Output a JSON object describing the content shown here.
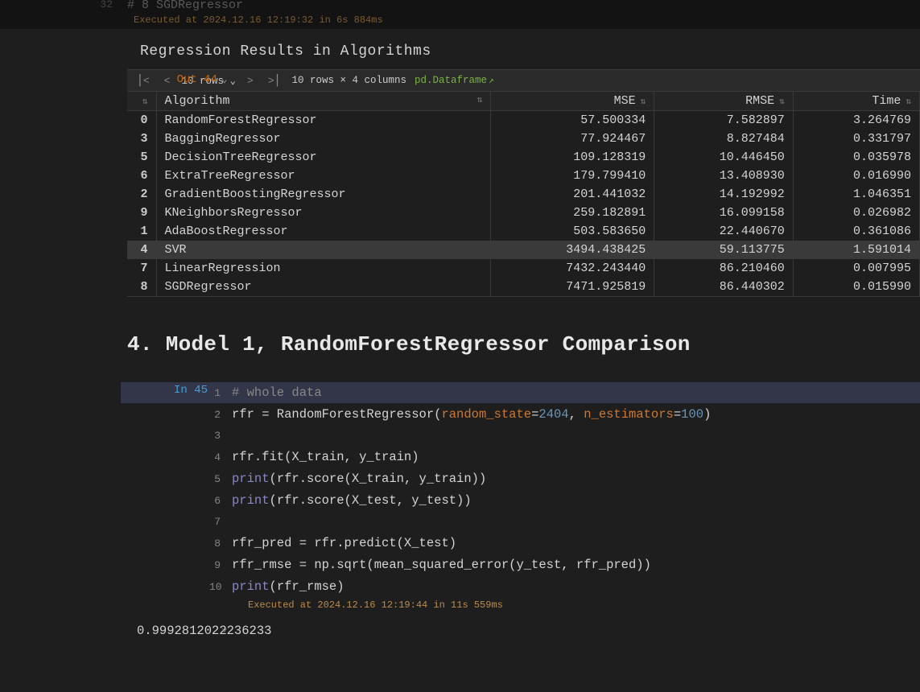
{
  "prev_cell": {
    "gutter": "32",
    "code_frag": "# 8 SGDRegressor",
    "exec": "Executed at 2024.12.16 12:19:32 in 6s 884ms"
  },
  "output_heading": "Regression Results in Algorithms",
  "out_label": "Out 44",
  "df_toolbar": {
    "rows_tag": "10 rows",
    "shape": "10 rows × 4 columns",
    "df_link": "pd.Dataframe"
  },
  "table": {
    "columns": [
      "Algorithm",
      "MSE",
      "RMSE",
      "Time"
    ],
    "rows": [
      {
        "idx": "0",
        "algo": "RandomForestRegressor",
        "mse": "57.500334",
        "rmse": "7.582897",
        "time": "3.264769",
        "cut": true
      },
      {
        "idx": "3",
        "algo": "BaggingRegressor",
        "mse": "77.924467",
        "rmse": "8.827484",
        "time": "0.331797"
      },
      {
        "idx": "5",
        "algo": "DecisionTreeRegressor",
        "mse": "109.128319",
        "rmse": "10.446450",
        "time": "0.035978"
      },
      {
        "idx": "6",
        "algo": "ExtraTreeRegressor",
        "mse": "179.799410",
        "rmse": "13.408930",
        "time": "0.016990"
      },
      {
        "idx": "2",
        "algo": "GradientBoostingRegressor",
        "mse": "201.441032",
        "rmse": "14.192992",
        "time": "1.046351"
      },
      {
        "idx": "9",
        "algo": "KNeighborsRegressor",
        "mse": "259.182891",
        "rmse": "16.099158",
        "time": "0.026982"
      },
      {
        "idx": "1",
        "algo": "AdaBoostRegressor",
        "mse": "503.583650",
        "rmse": "22.440670",
        "time": "0.361086"
      },
      {
        "idx": "4",
        "algo": "SVR",
        "mse": "3494.438425",
        "rmse": "59.113775",
        "time": "1.591014",
        "hl": true
      },
      {
        "idx": "7",
        "algo": "LinearRegression",
        "mse": "7432.243440",
        "rmse": "86.210460",
        "time": "0.007995"
      },
      {
        "idx": "8",
        "algo": "SGDRegressor",
        "mse": "7471.925819",
        "rmse": "86.440302",
        "time": "0.015990"
      }
    ]
  },
  "section_title": "4. Model 1, RandomForestRegressor Comparison",
  "in_label": "In 45",
  "code_lines": [
    {
      "n": "1",
      "html": "<span class='c-comment'># whole data</span>"
    },
    {
      "n": "2",
      "html": "rfr = RandomForestRegressor(<span class='c-param'>random_state</span>=<span class='c-num'>2404</span>, <span class='c-param'>n_estimators</span>=<span class='c-num'>100</span>)"
    },
    {
      "n": "3",
      "html": ""
    },
    {
      "n": "4",
      "html": "rfr.fit(X_train, y_train)"
    },
    {
      "n": "5",
      "html": "<span class='c-print'>print</span>(rfr.score(X_train, y_train))"
    },
    {
      "n": "6",
      "html": "<span class='c-print'>print</span>(rfr.score(X_test, y_test))"
    },
    {
      "n": "7",
      "html": ""
    },
    {
      "n": "8",
      "html": "rfr_pred = rfr.predict(X_test)"
    },
    {
      "n": "9",
      "html": "rfr_rmse = np.sqrt(mean_squared_error(y_test, rfr_pred))"
    },
    {
      "n": "10",
      "html": "<span class='c-print'>print</span>(rfr_rmse)"
    }
  ],
  "cell45_exec": "Executed at 2024.12.16 12:19:44 in 11s 559ms",
  "cell45_output": "0.9992812022236233"
}
